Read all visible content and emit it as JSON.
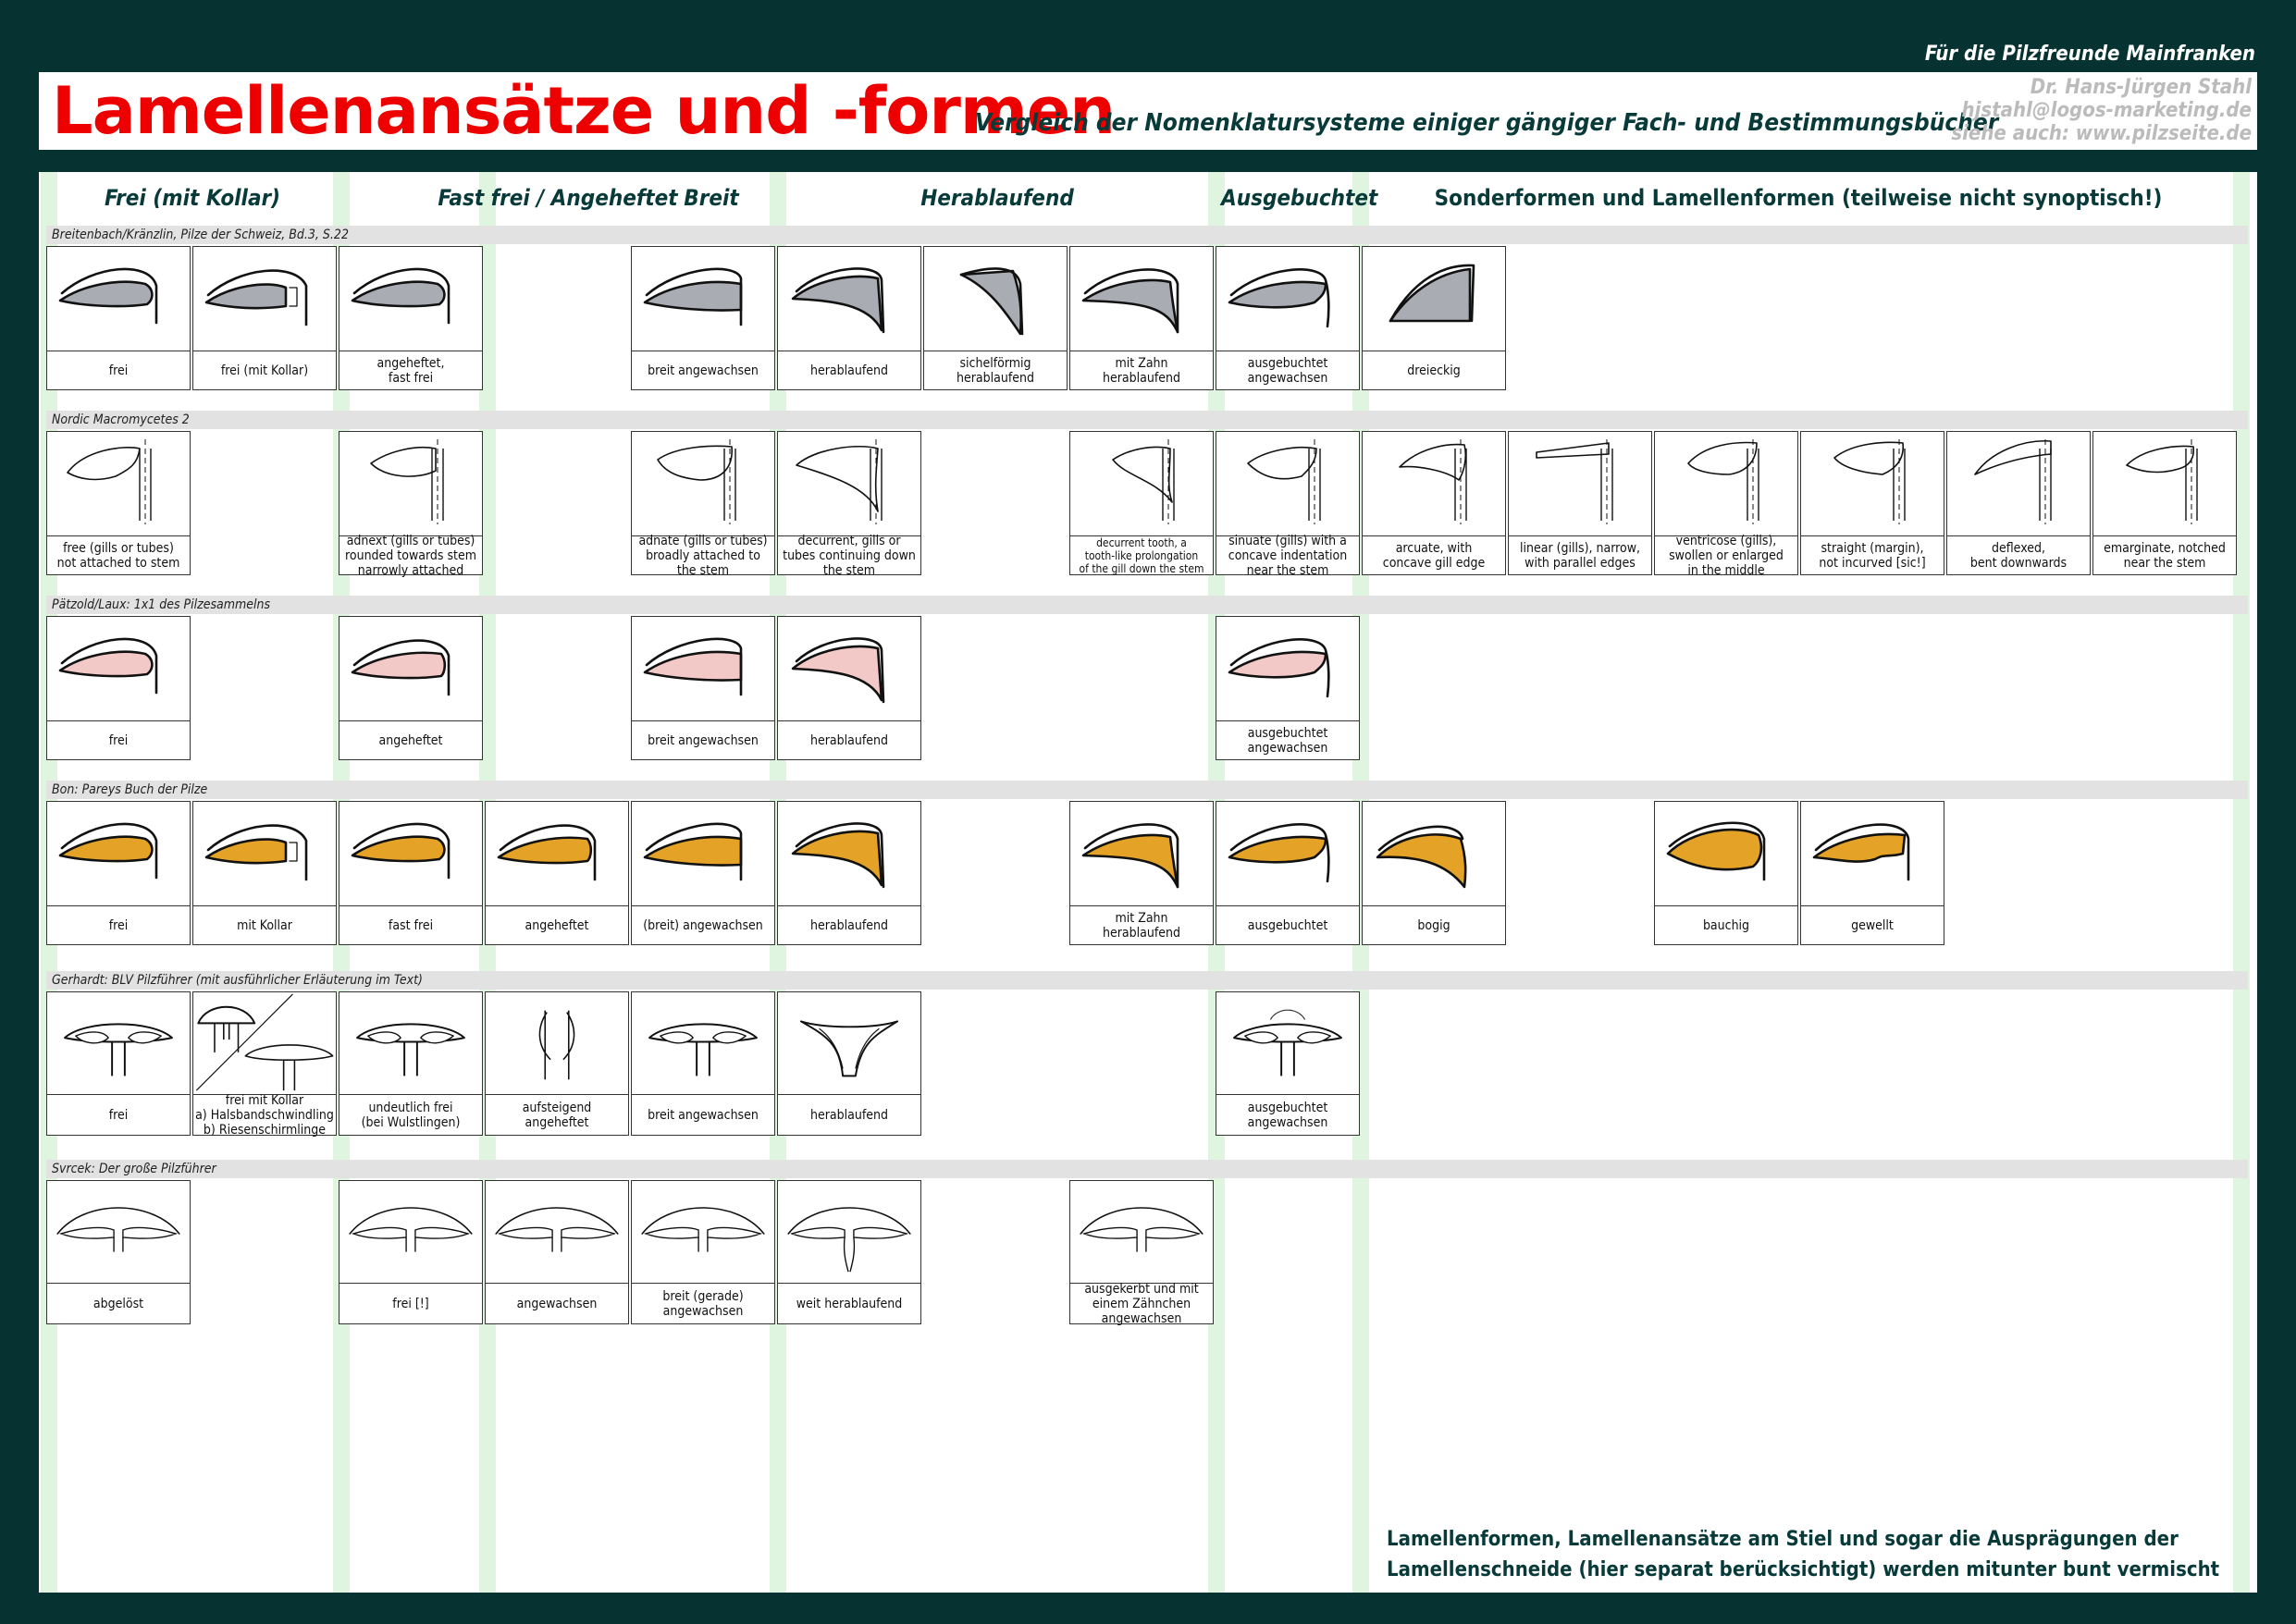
{
  "header": {
    "topline": "Für die Pilzfreunde Mainfranken",
    "title": "Lamellenansätze und -formen",
    "subtitle": "Vergleich der Nomenklatursysteme einiger gängiger Fach- und Bestimmungsbücher",
    "author": "Dr. Hans-Jürgen Stahl",
    "email": "hjstahl@logos-marketing.de",
    "website": "siehe auch: www.pilzseite.de"
  },
  "columns": [
    {
      "label": "Frei (mit Kollar)"
    },
    {
      "label": "Fast frei / Angeheftet"
    },
    {
      "label": "Breit"
    },
    {
      "label": "Herablaufend"
    },
    {
      "label": "Ausgebuchtet"
    },
    {
      "label": "Sonderformen und Lamellenformen (teilweise nicht synoptisch!)"
    }
  ],
  "sources": [
    {
      "name": "Breitenbach/Kränzlin, Pilze der Schweiz, Bd.3, S.22",
      "color": "#a9adb3",
      "cells": [
        {
          "label": "frei"
        },
        {
          "label": "frei (mit Kollar)"
        },
        {
          "label": "angeheftet,\nfast frei"
        },
        {
          "label": "breit angewachsen"
        },
        {
          "label": "herablaufend"
        },
        {
          "label": "sichelförmig\nherablaufend"
        },
        {
          "label": "mit Zahn\nherablaufend"
        },
        {
          "label": "ausgebuchtet\nangewachsen"
        },
        {
          "label": "dreieckig"
        }
      ]
    },
    {
      "name": "Nordic Macromycetes 2",
      "color": "#ffffff",
      "cells": [
        {
          "label": "free (gills or tubes)\nnot attached to stem"
        },
        {
          "label": "adnext (gills or tubes)\nrounded towards stem\nnarrowly attached"
        },
        {
          "label": "adnate (gills or tubes)\nbroadly attached to\nthe stem"
        },
        {
          "label": "decurrent, gills or\ntubes continuing down\nthe stem"
        },
        {
          "label": "decurrent tooth, a\ntooth-like prolongation\nof the gill down the stem"
        },
        {
          "label": "sinuate (gills) with a\nconcave indentation\nnear the stem"
        },
        {
          "label": "arcuate, with\nconcave gill edge"
        },
        {
          "label": "linear (gills), narrow,\nwith parallel edges"
        },
        {
          "label": "ventricose (gills),\nswollen or enlarged\nin the middle"
        },
        {
          "label": "straight (margin),\nnot incurved [sic!]"
        },
        {
          "label": "deflexed,\nbent downwards"
        },
        {
          "label": "emarginate, notched\nnear the stem"
        }
      ]
    },
    {
      "name": "Pätzold/Laux: 1x1 des Pilzesammelns",
      "color": "#f2c9c6",
      "cells": [
        {
          "label": "frei"
        },
        {
          "label": "angeheftet"
        },
        {
          "label": "breit angewachsen"
        },
        {
          "label": "herablaufend"
        },
        {
          "label": "ausgebuchtet\nangewachsen"
        }
      ]
    },
    {
      "name": "Bon: Pareys Buch der Pilze",
      "color": "#e4a326",
      "cells": [
        {
          "label": "frei"
        },
        {
          "label": "mit Kollar"
        },
        {
          "label": "fast frei"
        },
        {
          "label": "angeheftet"
        },
        {
          "label": "(breit) angewachsen"
        },
        {
          "label": "herablaufend"
        },
        {
          "label": "mit Zahn\nherablaufend"
        },
        {
          "label": "ausgebuchtet"
        },
        {
          "label": "bogig"
        },
        {
          "label": "bauchig"
        },
        {
          "label": "gewellt"
        }
      ]
    },
    {
      "name": "Gerhardt: BLV Pilzführer (mit ausführlicher Erläuterung im Text)",
      "cells": [
        {
          "label": "frei"
        },
        {
          "label": "frei mit Kollar\na) Halsbandschwindling\nb) Riesenschirmlinge"
        },
        {
          "label": "undeutlich frei\n(bei Wulstlingen)"
        },
        {
          "label": "aufsteigend\nangeheftet"
        },
        {
          "label": "breit angewachsen"
        },
        {
          "label": "herablaufend"
        },
        {
          "label": "ausgebuchtet\nangewachsen"
        }
      ]
    },
    {
      "name": "Svrcek: Der große Pilzführer",
      "cells": [
        {
          "label": "abgelöst"
        },
        {
          "label": "frei [!]"
        },
        {
          "label": "angewachsen"
        },
        {
          "label": "breit (gerade)\nangewachsen"
        },
        {
          "label": "weit herablaufend"
        },
        {
          "label": "ausgekerbt und mit\neinem Zähnchen\nangewachsen"
        }
      ]
    }
  ],
  "note": "Lamellenformen, Lamellenansätze am Stiel und sogar die Ausprägungen der Lamellenschneide (hier separat berücksichtigt) werden mitunter bunt vermischt"
}
